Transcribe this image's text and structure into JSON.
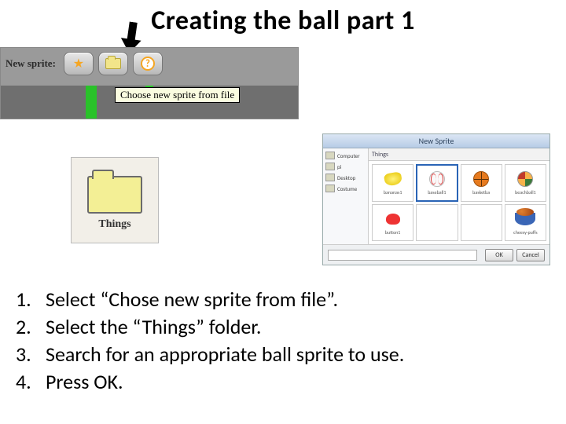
{
  "title": "Creating the ball part 1",
  "sprite_bar": {
    "label": "New sprite:",
    "tooltip": "Choose new sprite from file"
  },
  "things": {
    "label": "Things"
  },
  "dialog": {
    "title": "New Sprite",
    "path_label": "Things",
    "sidebar": [
      "Computer",
      "pi",
      "Desktop",
      "Costume"
    ],
    "items": [
      {
        "name": "bananas1",
        "icon": "bananas"
      },
      {
        "name": "baseball1",
        "icon": "baseball",
        "selected": true
      },
      {
        "name": "basketba",
        "icon": "basketball"
      },
      {
        "name": "beachball1",
        "icon": "beachball"
      },
      {
        "name": "button1",
        "icon": "redblob"
      },
      {
        "name": "",
        "icon": ""
      },
      {
        "name": "",
        "icon": ""
      },
      {
        "name": "cheesy-puffs",
        "icon": "bowl"
      }
    ],
    "ok": "OK",
    "cancel": "Cancel"
  },
  "steps": [
    "Select “Chose new sprite from file”.",
    "Select the “Things” folder.",
    "Search for an appropriate ball sprite to use.",
    "Press OK."
  ]
}
